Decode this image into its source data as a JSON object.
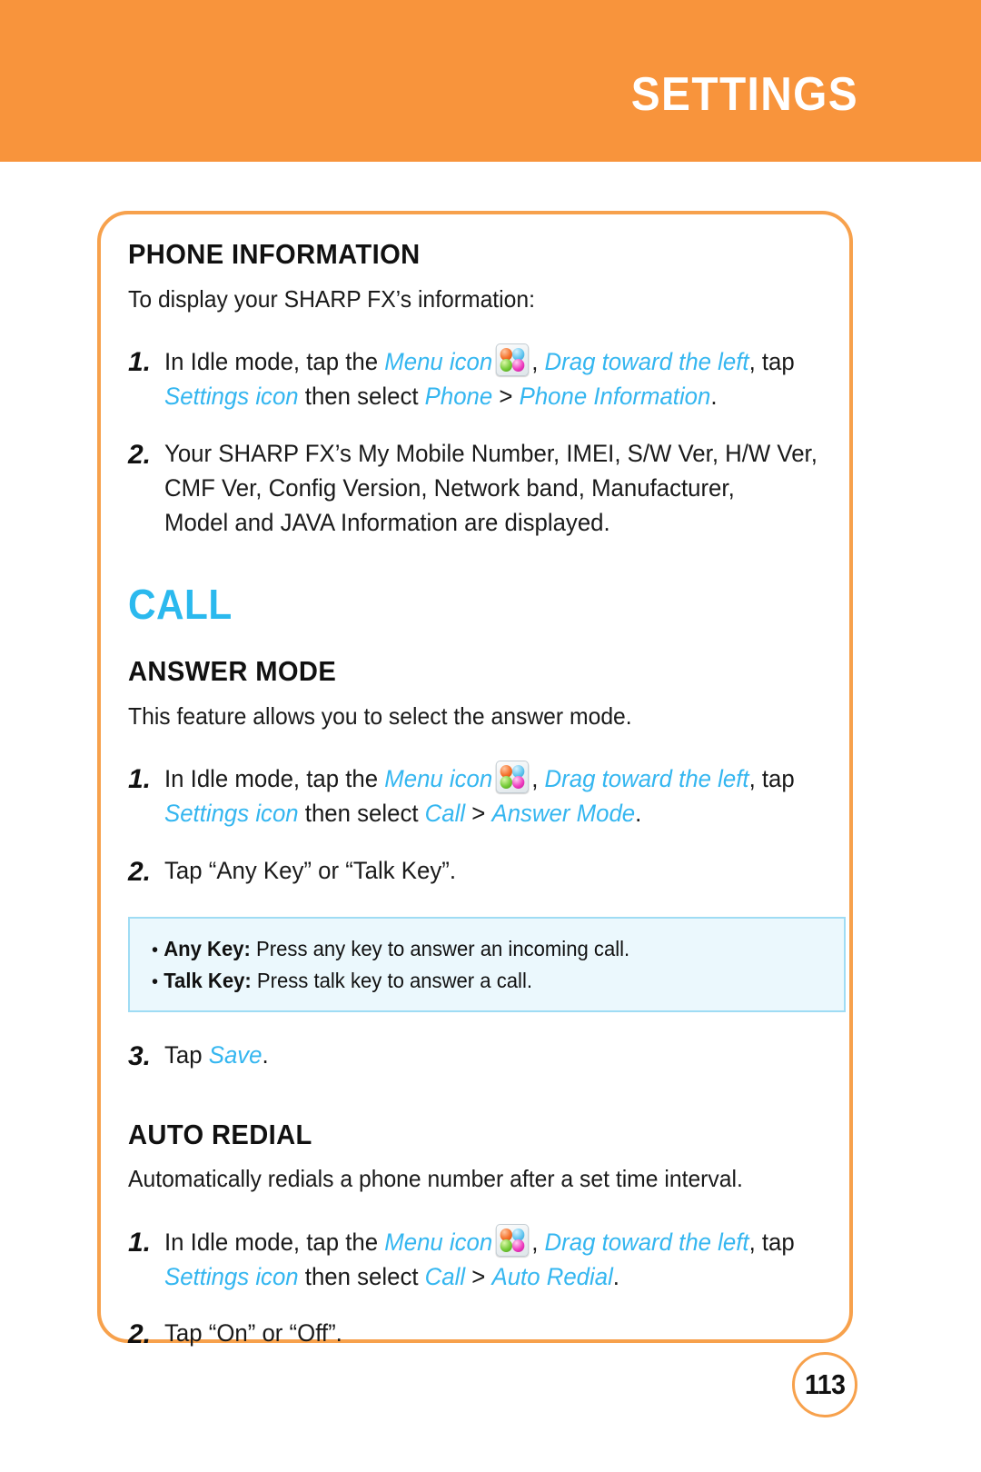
{
  "header": {
    "title": "SETTINGS",
    "band_color": "#F8943C"
  },
  "colors": {
    "header_orange": "#F8943C",
    "frame_orange": "#F7A14C",
    "accent_cyan": "#34B6F0",
    "heading_cyan": "#2BB9EE",
    "note_bg": "#EBF8FD",
    "note_border": "#9FDCF4",
    "text_black": "#1a1a1a"
  },
  "sections": [
    {
      "id": "phone-information",
      "heading": "PHONE INFORMATION",
      "intro": "To display your SHARP FX’s information:",
      "steps": [
        {
          "number": "1.",
          "line1": {
            "a_plain": "In Idle mode, tap the ",
            "b_hl": "Menu icon",
            "icon": "menu-grid-icon",
            "c_plain": ", ",
            "d_hl": "Drag toward the left",
            "e_plain": ", tap"
          },
          "line2": {
            "a_hl": "Settings icon",
            "b_plain": " then select ",
            "c_hl": "Phone",
            "d_plain": " > ",
            "e_hl": "Phone Information",
            "f_plain": "."
          }
        },
        {
          "number": "2.",
          "lines": [
            "Your SHARP FX’s My Mobile Number, IMEI, S/W Ver, H/W Ver,",
            "CMF Ver, Config Version, Network band, Manufacturer,",
            "Model and JAVA Information are displayed."
          ]
        }
      ]
    },
    {
      "id": "call",
      "big_heading": "CALL"
    },
    {
      "id": "answer-mode",
      "heading": "ANSWER MODE",
      "intro": "This feature allows you to select the answer mode.",
      "steps": [
        {
          "number": "1.",
          "line1": {
            "a_plain": "In Idle mode, tap the ",
            "b_hl": "Menu icon",
            "icon": "menu-grid-icon",
            "c_plain": ", ",
            "d_hl": "Drag toward the left",
            "e_plain": ", tap"
          },
          "line2": {
            "a_hl": "Settings icon",
            "b_plain": " then select ",
            "c_hl": "Call",
            "d_plain": " > ",
            "e_hl": "Answer Mode",
            "f_plain": "."
          }
        },
        {
          "number": "2.",
          "lines": [
            "Tap “Any Key” or “Talk Key”."
          ]
        },
        {
          "number": "3.",
          "tap_prefix": "Tap ",
          "tap_hl": "Save",
          "tap_suffix": "."
        }
      ],
      "note": {
        "items": [
          {
            "bullet": "•",
            "term": "Any Key:",
            "text": " Press any key to answer an incoming call."
          },
          {
            "bullet": "•",
            "term": "Talk Key:",
            "text": " Press talk key to answer a call."
          }
        ]
      }
    },
    {
      "id": "auto-redial",
      "heading": "AUTO REDIAL",
      "intro": "Automatically redials a phone number after a set time interval.",
      "steps": [
        {
          "number": "1.",
          "line1": {
            "a_plain": "In Idle mode, tap the ",
            "b_hl": "Menu icon",
            "icon": "menu-grid-icon",
            "c_plain": ", ",
            "d_hl": "Drag toward the left",
            "e_plain": ", tap"
          },
          "line2": {
            "a_hl": "Settings icon",
            "b_plain": " then select ",
            "c_hl": "Call",
            "d_plain": " > ",
            "e_hl": "Auto Redial",
            "f_plain": "."
          }
        },
        {
          "number": "2.",
          "lines": [
            "Tap “On” or “Off”."
          ]
        }
      ]
    }
  ],
  "footer": {
    "page_number": "113"
  }
}
